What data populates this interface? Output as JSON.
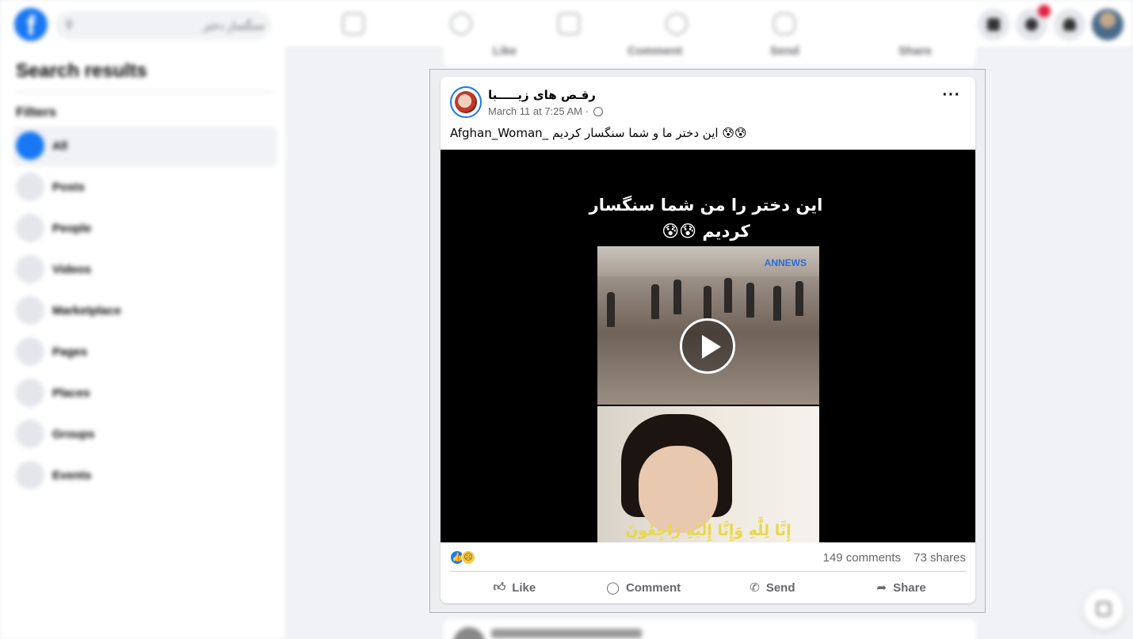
{
  "topbar": {
    "logo_letter": "f",
    "search_placeholder": "سنگسار دختر"
  },
  "sidebar": {
    "title": "Search results",
    "filters_label": "Filters",
    "items": [
      {
        "label": "All"
      },
      {
        "label": "Posts"
      },
      {
        "label": "People"
      },
      {
        "label": "Videos"
      },
      {
        "label": "Marketplace"
      },
      {
        "label": "Pages"
      },
      {
        "label": "Places"
      },
      {
        "label": "Groups"
      },
      {
        "label": "Events"
      }
    ]
  },
  "bg_actions": {
    "like": "Like",
    "comment": "Comment",
    "send": "Send",
    "share": "Share"
  },
  "post": {
    "author": "رقـص های زیـــــبا",
    "timestamp": "March 11 at 7:25 AM",
    "separator": "·",
    "text": "Afghan_Woman_ این دختر ما و شما سنگسار کردیم 😰😰",
    "video": {
      "overlay_title": "این دختر را من شما سنگسار کردیم 😰😰",
      "channel_logo": "ANNEWS",
      "subtitle": "إِنَّا لِلَّٰهِ وَإِنَّا إِلَيْهِ رَاجِعُونَ"
    },
    "reaction_icons": [
      "like-reaction",
      "sad-reaction"
    ],
    "comments_count": "149 comments",
    "shares_count": "73 shares",
    "actions": {
      "like": "Like",
      "comment": "Comment",
      "send": "Send",
      "share": "Share"
    }
  },
  "colors": {
    "brand": "#1877f2",
    "background": "#f0f2f5",
    "secondary_text": "#65676b",
    "notification": "#e41e3f"
  }
}
